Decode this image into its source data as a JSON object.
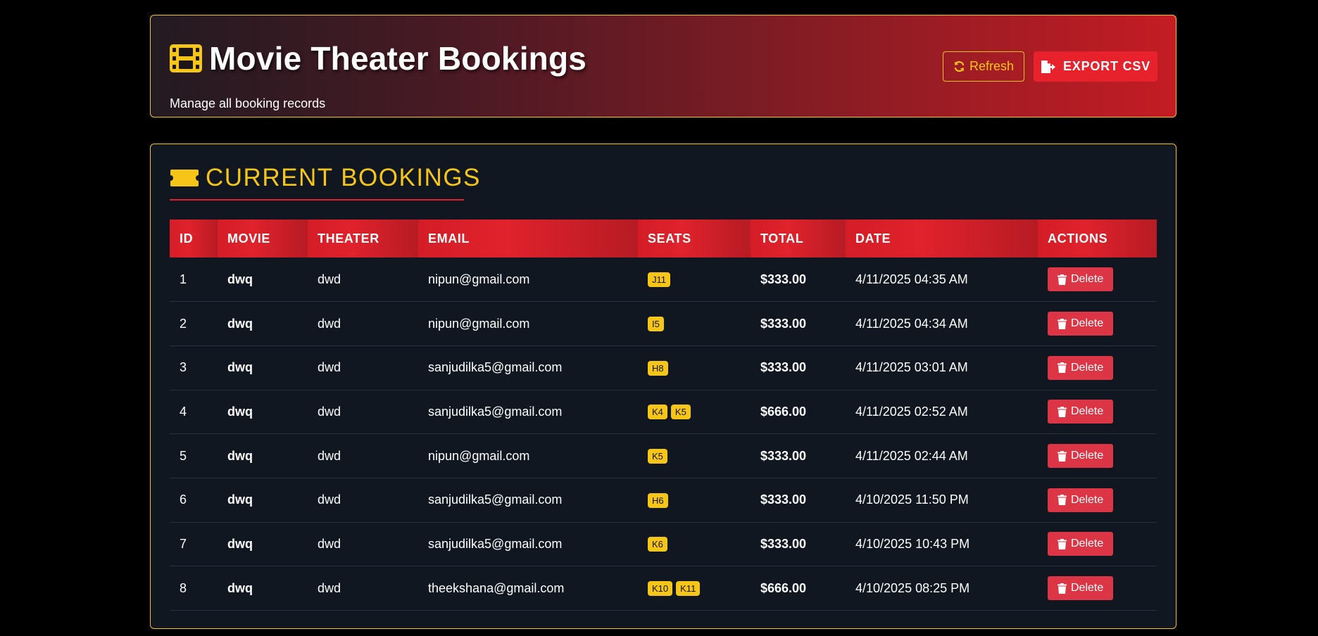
{
  "header": {
    "title": "Movie Theater Bookings",
    "subtitle": "Manage all booking records",
    "refresh_label": "Refresh",
    "export_label": "EXPORT CSV"
  },
  "section": {
    "title": "CURRENT BOOKINGS"
  },
  "table": {
    "columns": [
      "ID",
      "MOVIE",
      "THEATER",
      "EMAIL",
      "SEATS",
      "TOTAL",
      "DATE",
      "ACTIONS"
    ],
    "delete_label": "Delete",
    "rows": [
      {
        "id": "1",
        "movie": "dwq",
        "theater": "dwd",
        "email": "nipun@gmail.com",
        "seats": [
          "J11"
        ],
        "total": "$333.00",
        "date": "4/11/2025 04:35 AM"
      },
      {
        "id": "2",
        "movie": "dwq",
        "theater": "dwd",
        "email": "nipun@gmail.com",
        "seats": [
          "I5"
        ],
        "total": "$333.00",
        "date": "4/11/2025 04:34 AM"
      },
      {
        "id": "3",
        "movie": "dwq",
        "theater": "dwd",
        "email": "sanjudilka5@gmail.com",
        "seats": [
          "H8"
        ],
        "total": "$333.00",
        "date": "4/11/2025 03:01 AM"
      },
      {
        "id": "4",
        "movie": "dwq",
        "theater": "dwd",
        "email": "sanjudilka5@gmail.com",
        "seats": [
          "K4",
          "K5"
        ],
        "total": "$666.00",
        "date": "4/11/2025 02:52 AM"
      },
      {
        "id": "5",
        "movie": "dwq",
        "theater": "dwd",
        "email": "nipun@gmail.com",
        "seats": [
          "K5"
        ],
        "total": "$333.00",
        "date": "4/11/2025 02:44 AM"
      },
      {
        "id": "6",
        "movie": "dwq",
        "theater": "dwd",
        "email": "sanjudilka5@gmail.com",
        "seats": [
          "H6"
        ],
        "total": "$333.00",
        "date": "4/10/2025 11:50 PM"
      },
      {
        "id": "7",
        "movie": "dwq",
        "theater": "dwd",
        "email": "sanjudilka5@gmail.com",
        "seats": [
          "K6"
        ],
        "total": "$333.00",
        "date": "4/10/2025 10:43 PM"
      },
      {
        "id": "8",
        "movie": "dwq",
        "theater": "dwd",
        "email": "theekshana@gmail.com",
        "seats": [
          "K10",
          "K11"
        ],
        "total": "$666.00",
        "date": "4/10/2025 08:25 PM"
      }
    ]
  },
  "colors": {
    "accent_gold": "#f5c518",
    "accent_red": "#e8222d",
    "delete_red": "#dc3545",
    "panel_bg": "#101720"
  },
  "icons": {
    "title": "film-icon",
    "section": "ticket-icon",
    "refresh": "sync-icon",
    "export": "file-export-icon",
    "delete": "trash-icon"
  }
}
